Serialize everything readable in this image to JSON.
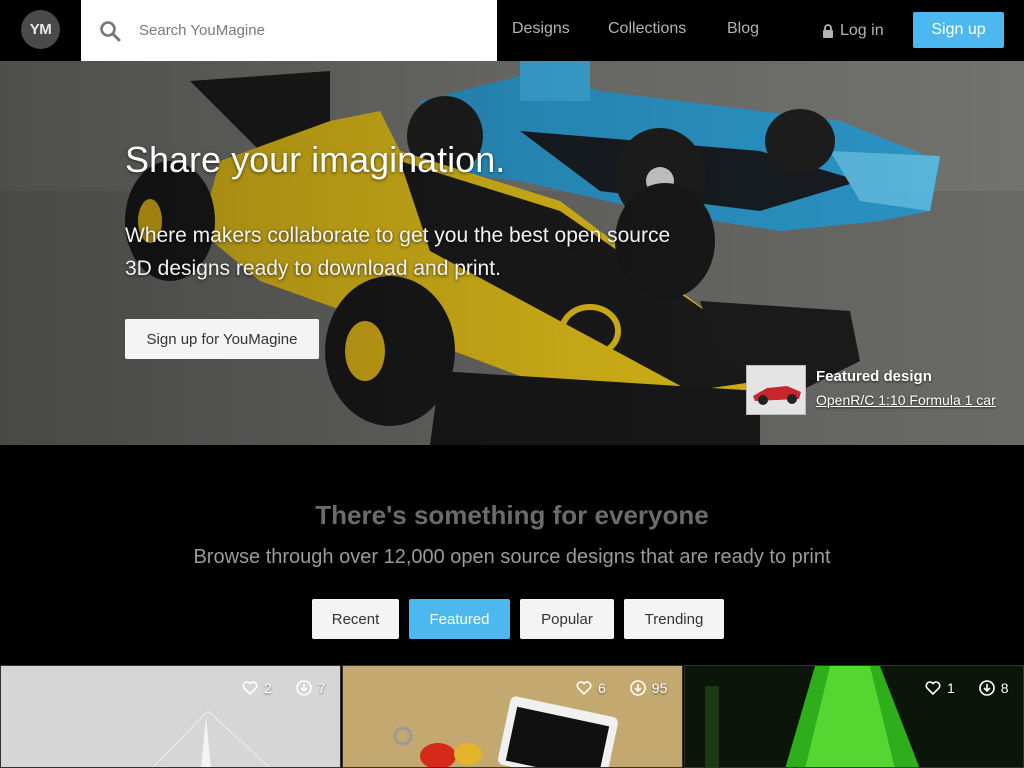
{
  "header": {
    "logo_text": "YM",
    "search_placeholder": "Search YouMagine",
    "nav": [
      "Designs",
      "Collections",
      "Blog"
    ],
    "login_label": "Log in",
    "signup_label": "Sign up"
  },
  "hero": {
    "title": "Share your imagination.",
    "subtitle_line1": "Where makers collaborate to get you the best open source",
    "subtitle_line2": "3D designs ready to download and print.",
    "cta_label": "Sign up for YouMagine",
    "featured_label": "Featured design",
    "featured_link": "OpenR/C 1:10 Formula 1 car"
  },
  "browse": {
    "title": "There's something for everyone",
    "subtitle": "Browse through over 12,000 open source designs that are ready to print",
    "tabs": [
      "Recent",
      "Featured",
      "Popular",
      "Trending"
    ],
    "active_tab": "Featured"
  },
  "cards": [
    {
      "likes": "2",
      "downloads": "7"
    },
    {
      "likes": "6",
      "downloads": "95"
    },
    {
      "likes": "1",
      "downloads": "8"
    }
  ],
  "colors": {
    "accent": "#4db8f0",
    "background": "#000000"
  }
}
